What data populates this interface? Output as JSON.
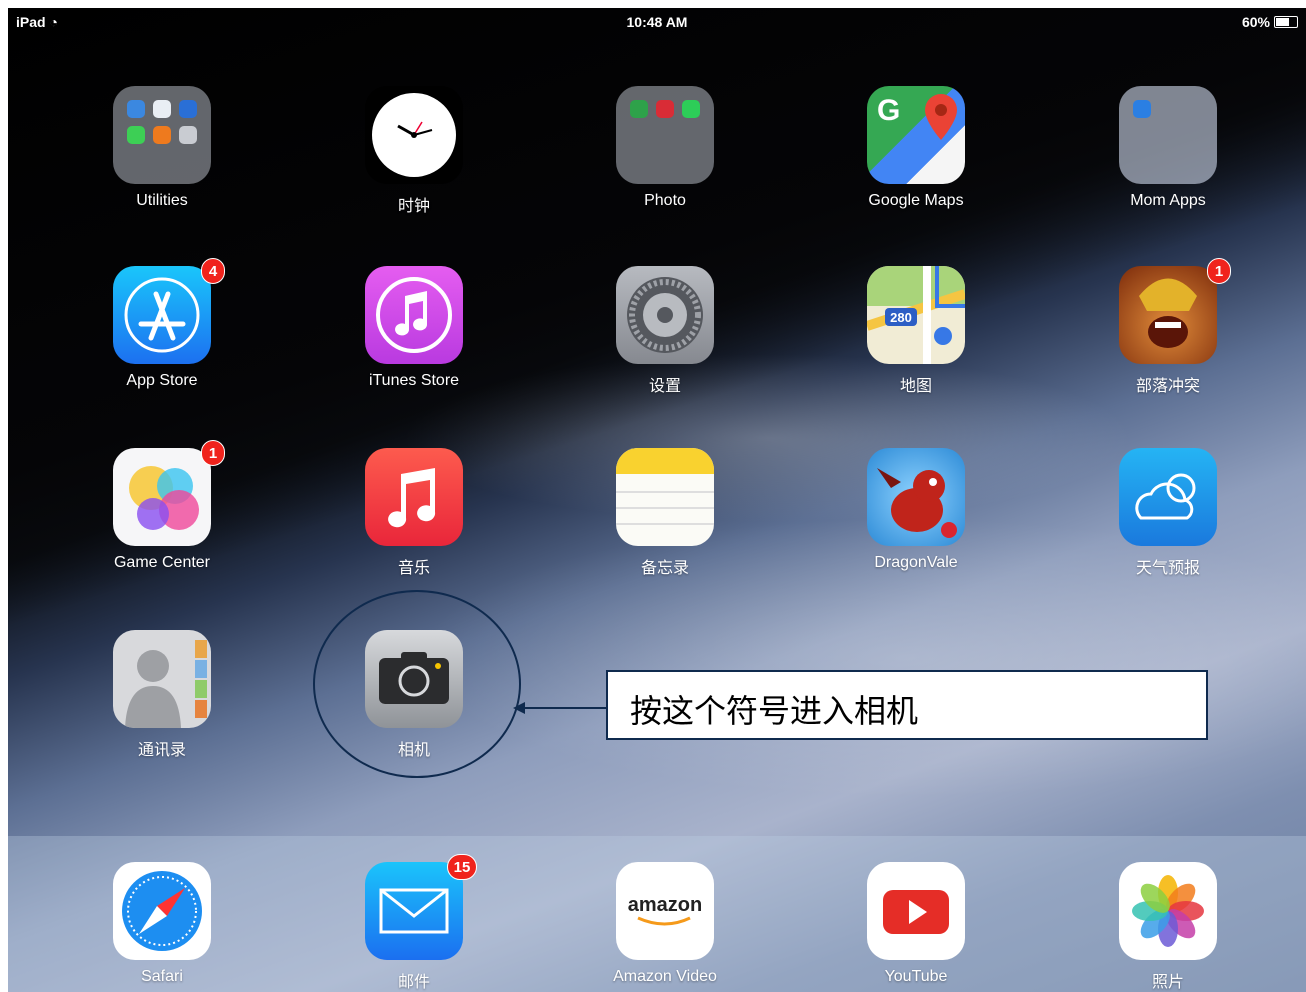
{
  "status_bar": {
    "device": "iPad",
    "time": "10:48 AM",
    "battery": "60%"
  },
  "rows": [
    [
      {
        "label": "Utilities",
        "icon": "utilities-folder-icon"
      },
      {
        "label": "时钟",
        "icon": "clock-icon"
      },
      {
        "label": "Photo",
        "icon": "photo-folder-icon"
      },
      {
        "label": "Google Maps",
        "icon": "google-maps-icon"
      },
      {
        "label": "Mom Apps",
        "icon": "mom-apps-folder-icon"
      }
    ],
    [
      {
        "label": "App Store",
        "icon": "app-store-icon",
        "badge": "4"
      },
      {
        "label": "iTunes Store",
        "icon": "itunes-store-icon"
      },
      {
        "label": "设置",
        "icon": "settings-icon"
      },
      {
        "label": "地图",
        "icon": "maps-icon",
        "route": "280"
      },
      {
        "label": "部落冲突",
        "icon": "clash-of-clans-icon",
        "badge": "1"
      }
    ],
    [
      {
        "label": "Game Center",
        "icon": "game-center-icon",
        "badge": "1"
      },
      {
        "label": "音乐",
        "icon": "music-icon"
      },
      {
        "label": "备忘录",
        "icon": "notes-icon"
      },
      {
        "label": "DragonVale",
        "icon": "dragonvale-icon"
      },
      {
        "label": "天气预报",
        "icon": "weather-icon"
      }
    ],
    [
      {
        "label": "通讯录",
        "icon": "contacts-icon"
      },
      {
        "label": "相机",
        "icon": "camera-icon"
      }
    ]
  ],
  "dock": [
    {
      "label": "Safari",
      "icon": "safari-icon"
    },
    {
      "label": "邮件",
      "icon": "mail-icon",
      "badge": "15"
    },
    {
      "label": "Amazon Video",
      "icon": "amazon-video-icon",
      "logo_text": "amazon"
    },
    {
      "label": "YouTube",
      "icon": "youtube-icon"
    },
    {
      "label": "照片",
      "icon": "photos-icon"
    }
  ],
  "annotation": {
    "text": "按这个符号进入相机"
  },
  "colors": {
    "badge": "#f0231c",
    "annotation_line": "#0f2a4e"
  }
}
